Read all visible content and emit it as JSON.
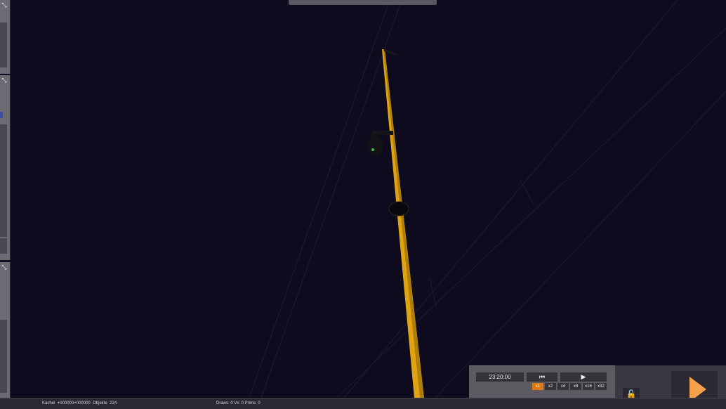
{
  "status": {
    "tile_label": "Kachel",
    "tile_value": "+000000+000000",
    "objects_label": "Objekte",
    "objects_value": "224",
    "draws_text": "Draws: 0 Vx: 0 Prims: 0"
  },
  "controls": {
    "time": "23:20:00",
    "rewind_icon": "skip-back-icon",
    "rewind_symbol": "⏮",
    "play_icon": "play-icon",
    "play_symbol": "▶",
    "speeds": [
      "x1",
      "x2",
      "x4",
      "x8",
      "x16",
      "x32"
    ],
    "active_speed": "x1",
    "lock_icon": "unlock-icon",
    "lock_symbol": "🔓",
    "big_play_icon": "play-triangle-icon"
  },
  "panels": {
    "pin_icon": "pin-icon",
    "pin_symbol": "⤡"
  },
  "colors": {
    "sky": "#0e0b1e",
    "pole": "#e0a412",
    "accent": "#e07a10",
    "play_triangle": "#f5a04a"
  }
}
